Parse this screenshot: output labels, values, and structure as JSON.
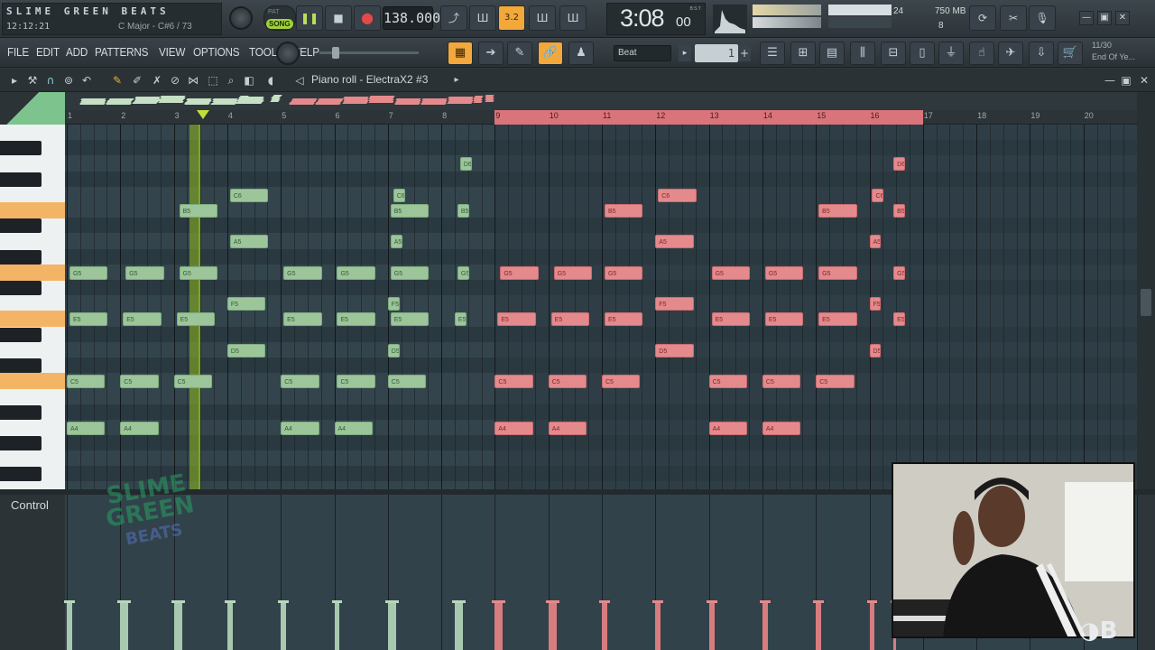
{
  "header": {
    "app_title": "SLIME GREEN BEATS",
    "clock": "12:12:21",
    "key_info": "C Major - C#6 / 73",
    "song_mode": "SONG",
    "pattern_mode": "PAT",
    "tempo": "138.000",
    "time": "3:08",
    "time_sub": "00",
    "time_unit": "B:S:T",
    "meter_value": "24",
    "memory": "750 MB",
    "voices": "8"
  },
  "menu": {
    "items": [
      "FILE",
      "EDIT",
      "ADD",
      "PATTERNS",
      "VIEW",
      "OPTIONS",
      "TOOLS",
      "HELP"
    ],
    "pattern_select": "Beat",
    "pattern_number": "1",
    "hint_top": "11/30",
    "hint_bottom": "End Of Ye..."
  },
  "piano_roll": {
    "title": "Piano roll - ElectraX2 #3",
    "bars": [
      "1",
      "2",
      "3",
      "4",
      "5",
      "6",
      "7",
      "8",
      "9",
      "10",
      "11",
      "12",
      "13",
      "14",
      "15",
      "16",
      "17",
      "18",
      "19",
      "20"
    ]
  },
  "notes": [
    {
      "pitch": "D6",
      "start": 8.35,
      "len": 0.25,
      "color": "green"
    },
    {
      "pitch": "C6",
      "start": 4.05,
      "len": 0.75,
      "color": "green"
    },
    {
      "pitch": "C6",
      "start": 7.1,
      "len": 0.25,
      "color": "green"
    },
    {
      "pitch": "B5",
      "start": 3.1,
      "len": 0.75,
      "color": "green"
    },
    {
      "pitch": "B5",
      "start": 7.05,
      "len": 0.75,
      "color": "green"
    },
    {
      "pitch": "B5",
      "start": 8.3,
      "len": 0.25,
      "color": "green"
    },
    {
      "pitch": "A5",
      "start": 4.05,
      "len": 0.75,
      "color": "green"
    },
    {
      "pitch": "A5",
      "start": 7.05,
      "len": 0.25,
      "color": "green"
    },
    {
      "pitch": "G5",
      "start": 1.05,
      "len": 0.75,
      "color": "green"
    },
    {
      "pitch": "G5",
      "start": 2.1,
      "len": 0.75,
      "color": "green"
    },
    {
      "pitch": "G5",
      "start": 3.1,
      "len": 0.75,
      "color": "green"
    },
    {
      "pitch": "G5",
      "start": 5.05,
      "len": 0.75,
      "color": "green"
    },
    {
      "pitch": "G5",
      "start": 6.05,
      "len": 0.75,
      "color": "green"
    },
    {
      "pitch": "G5",
      "start": 7.05,
      "len": 0.75,
      "color": "green"
    },
    {
      "pitch": "G5",
      "start": 8.3,
      "len": 0.25,
      "color": "green"
    },
    {
      "pitch": "F5",
      "start": 4.0,
      "len": 0.75,
      "color": "green"
    },
    {
      "pitch": "F5",
      "start": 7.0,
      "len": 0.25,
      "color": "green"
    },
    {
      "pitch": "E5",
      "start": 1.05,
      "len": 0.75,
      "color": "green"
    },
    {
      "pitch": "E5",
      "start": 2.05,
      "len": 0.75,
      "color": "green"
    },
    {
      "pitch": "E5",
      "start": 3.05,
      "len": 0.75,
      "color": "green"
    },
    {
      "pitch": "E5",
      "start": 5.05,
      "len": 0.75,
      "color": "green"
    },
    {
      "pitch": "E5",
      "start": 6.05,
      "len": 0.75,
      "color": "green"
    },
    {
      "pitch": "E5",
      "start": 7.05,
      "len": 0.75,
      "color": "green"
    },
    {
      "pitch": "E5",
      "start": 8.25,
      "len": 0.25,
      "color": "green"
    },
    {
      "pitch": "D5",
      "start": 4.0,
      "len": 0.75,
      "color": "green"
    },
    {
      "pitch": "D5",
      "start": 7.0,
      "len": 0.25,
      "color": "green"
    },
    {
      "pitch": "C5",
      "start": 1.0,
      "len": 0.75,
      "color": "green"
    },
    {
      "pitch": "C5",
      "start": 2.0,
      "len": 0.75,
      "color": "green"
    },
    {
      "pitch": "C5",
      "start": 3.0,
      "len": 0.75,
      "color": "green"
    },
    {
      "pitch": "C5",
      "start": 5.0,
      "len": 0.75,
      "color": "green"
    },
    {
      "pitch": "C5",
      "start": 6.05,
      "len": 0.75,
      "color": "green"
    },
    {
      "pitch": "C5",
      "start": 7.0,
      "len": 0.75,
      "color": "green"
    },
    {
      "pitch": "A4",
      "start": 1.0,
      "len": 0.75,
      "color": "green"
    },
    {
      "pitch": "A4",
      "start": 2.0,
      "len": 0.75,
      "color": "green"
    },
    {
      "pitch": "A4",
      "start": 5.0,
      "len": 0.75,
      "color": "green"
    },
    {
      "pitch": "A4",
      "start": 6.0,
      "len": 0.75,
      "color": "green"
    },
    {
      "pitch": "D6",
      "start": 16.45,
      "len": 0.25,
      "color": "red"
    },
    {
      "pitch": "C6",
      "start": 12.05,
      "len": 0.75,
      "color": "red"
    },
    {
      "pitch": "C6",
      "start": 16.05,
      "len": 0.25,
      "color": "red"
    },
    {
      "pitch": "B5",
      "start": 11.05,
      "len": 0.75,
      "color": "red"
    },
    {
      "pitch": "B5",
      "start": 15.05,
      "len": 0.75,
      "color": "red"
    },
    {
      "pitch": "B5",
      "start": 16.45,
      "len": 0.25,
      "color": "red"
    },
    {
      "pitch": "A5",
      "start": 12.0,
      "len": 0.75,
      "color": "red"
    },
    {
      "pitch": "A5",
      "start": 16.0,
      "len": 0.25,
      "color": "red"
    },
    {
      "pitch": "G5",
      "start": 9.1,
      "len": 0.75,
      "color": "red"
    },
    {
      "pitch": "G5",
      "start": 10.1,
      "len": 0.75,
      "color": "red"
    },
    {
      "pitch": "G5",
      "start": 11.05,
      "len": 0.75,
      "color": "red"
    },
    {
      "pitch": "G5",
      "start": 13.05,
      "len": 0.75,
      "color": "red"
    },
    {
      "pitch": "G5",
      "start": 14.05,
      "len": 0.75,
      "color": "red"
    },
    {
      "pitch": "G5",
      "start": 15.05,
      "len": 0.75,
      "color": "red"
    },
    {
      "pitch": "G5",
      "start": 16.45,
      "len": 0.25,
      "color": "red"
    },
    {
      "pitch": "F5",
      "start": 12.0,
      "len": 0.75,
      "color": "red"
    },
    {
      "pitch": "F5",
      "start": 16.0,
      "len": 0.25,
      "color": "red"
    },
    {
      "pitch": "E5",
      "start": 9.05,
      "len": 0.75,
      "color": "red"
    },
    {
      "pitch": "E5",
      "start": 10.05,
      "len": 0.75,
      "color": "red"
    },
    {
      "pitch": "E5",
      "start": 11.05,
      "len": 0.75,
      "color": "red"
    },
    {
      "pitch": "E5",
      "start": 13.05,
      "len": 0.75,
      "color": "red"
    },
    {
      "pitch": "E5",
      "start": 14.05,
      "len": 0.75,
      "color": "red"
    },
    {
      "pitch": "E5",
      "start": 15.05,
      "len": 0.75,
      "color": "red"
    },
    {
      "pitch": "E5",
      "start": 16.45,
      "len": 0.25,
      "color": "red"
    },
    {
      "pitch": "D5",
      "start": 12.0,
      "len": 0.75,
      "color": "red"
    },
    {
      "pitch": "D5",
      "start": 16.0,
      "len": 0.25,
      "color": "red"
    },
    {
      "pitch": "C5",
      "start": 9.0,
      "len": 0.75,
      "color": "red"
    },
    {
      "pitch": "C5",
      "start": 10.0,
      "len": 0.75,
      "color": "red"
    },
    {
      "pitch": "C5",
      "start": 11.0,
      "len": 0.75,
      "color": "red"
    },
    {
      "pitch": "C5",
      "start": 13.0,
      "len": 0.75,
      "color": "red"
    },
    {
      "pitch": "C5",
      "start": 14.0,
      "len": 0.75,
      "color": "red"
    },
    {
      "pitch": "C5",
      "start": 15.0,
      "len": 0.75,
      "color": "red"
    },
    {
      "pitch": "A4",
      "start": 9.0,
      "len": 0.75,
      "color": "red"
    },
    {
      "pitch": "A4",
      "start": 10.0,
      "len": 0.75,
      "color": "red"
    },
    {
      "pitch": "A4",
      "start": 13.0,
      "len": 0.75,
      "color": "red"
    },
    {
      "pitch": "A4",
      "start": 14.0,
      "len": 0.75,
      "color": "red"
    }
  ],
  "control": {
    "label": "Control"
  },
  "watermark": {
    "line1": "SLIME",
    "line2": "GREEN",
    "line3": "BEATS"
  },
  "colors": {
    "accent": "#f3a83b",
    "green_note": "#9cc69a",
    "red_note": "#e58a8c",
    "song_on": "#9ed23a"
  }
}
